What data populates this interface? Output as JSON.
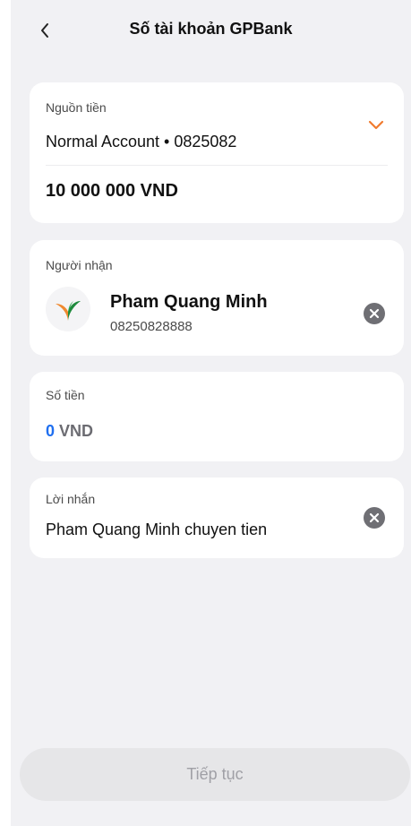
{
  "header": {
    "title": "Số tài khoản GPBank",
    "back_icon": "chevron-left-icon"
  },
  "source": {
    "label": "Nguồn tiền",
    "account": "Normal Account • 0825082",
    "balance": "10 000 000 VND",
    "dropdown_icon": "chevron-down-icon",
    "accent_color": "#f07b2f"
  },
  "recipient": {
    "label": "Người nhận",
    "name": "Pham Quang Minh",
    "account_number": "08250828888",
    "logo_icon": "bank-logo-icon",
    "clear_icon": "clear-circle-icon"
  },
  "amount": {
    "label": "Số tiền",
    "value": "0",
    "unit": "VND",
    "value_color": "#1f6ff0"
  },
  "message": {
    "label": "Lời nhắn",
    "text": "Pham Quang Minh chuyen tien",
    "clear_icon": "clear-circle-icon"
  },
  "footer": {
    "continue_label": "Tiếp tục"
  }
}
